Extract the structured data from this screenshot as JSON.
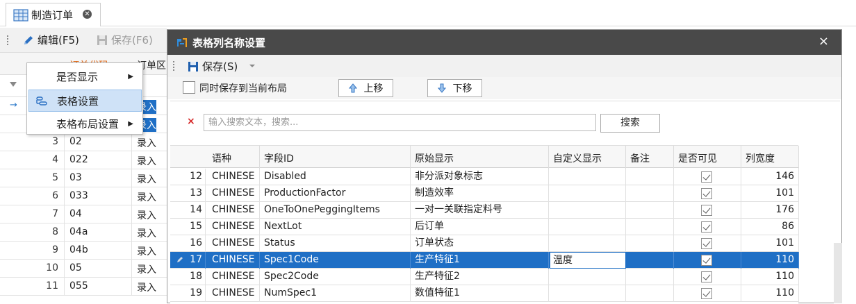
{
  "tab": {
    "label": "制造订单",
    "icon": "table-icon",
    "close_icon": "close-circle-icon"
  },
  "bg_toolbar": {
    "edit_label": "编辑(F5)",
    "save_label": "保存(F6)"
  },
  "bg_grid": {
    "header": {
      "code": "订单代码",
      "type": "订单区"
    },
    "rows": [
      {
        "num": "",
        "code": "",
        "type": "录入"
      },
      {
        "num": "",
        "code": "",
        "type": "录入"
      },
      {
        "num": "3",
        "code": "02",
        "type": "录入"
      },
      {
        "num": "4",
        "code": "022",
        "type": "录入"
      },
      {
        "num": "5",
        "code": "03",
        "type": "录入"
      },
      {
        "num": "6",
        "code": "033",
        "type": "录入"
      },
      {
        "num": "7",
        "code": "04",
        "type": "录入"
      },
      {
        "num": "8",
        "code": "04a",
        "type": "录入"
      },
      {
        "num": "9",
        "code": "04b",
        "type": "录入"
      },
      {
        "num": "10",
        "code": "05",
        "type": "录入"
      },
      {
        "num": "11",
        "code": "055",
        "type": "录入"
      }
    ]
  },
  "context_menu": {
    "items": [
      {
        "label": "是否显示",
        "has_submenu": true
      },
      {
        "label": "表格设置",
        "has_submenu": false,
        "icon": "table-settings-icon"
      },
      {
        "label": "表格布局设置",
        "has_submenu": true
      }
    ]
  },
  "dialog": {
    "title": "表格列名称设置",
    "close": "×",
    "save_label": "保存(S)",
    "sync_checkbox_label": "同时保存到当前布局",
    "move_up_label": "上移",
    "move_down_label": "下移",
    "search_placeholder": "输入搜索文本，搜索...",
    "search_button": "搜索",
    "clear_icon": "×",
    "columns": [
      "语种",
      "字段ID",
      "原始显示",
      "自定义显示",
      "备注",
      "是否可见",
      "列宽度"
    ],
    "rows": [
      {
        "num": "12",
        "lang": "CHINESE",
        "field": "Disabled",
        "orig": "非分派对象标志",
        "custom": "",
        "note": "",
        "visible": true,
        "width": "146"
      },
      {
        "num": "13",
        "lang": "CHINESE",
        "field": "ProductionFactor",
        "orig": "制造效率",
        "custom": "",
        "note": "",
        "visible": true,
        "width": "101"
      },
      {
        "num": "14",
        "lang": "CHINESE",
        "field": "OneToOnePeggingItems",
        "orig": "一对一关联指定料号",
        "custom": "",
        "note": "",
        "visible": true,
        "width": "176"
      },
      {
        "num": "15",
        "lang": "CHINESE",
        "field": "NextLot",
        "orig": "后订单",
        "custom": "",
        "note": "",
        "visible": true,
        "width": "86"
      },
      {
        "num": "16",
        "lang": "CHINESE",
        "field": "Status",
        "orig": "订单状态",
        "custom": "",
        "note": "",
        "visible": true,
        "width": "101"
      },
      {
        "num": "17",
        "lang": "CHINESE",
        "field": "Spec1Code",
        "orig": "生产特征1",
        "custom": "温度",
        "note": "",
        "visible": true,
        "width": "110",
        "selected": true
      },
      {
        "num": "18",
        "lang": "CHINESE",
        "field": "Spec2Code",
        "orig": "生产特征2",
        "custom": "",
        "note": "",
        "visible": true,
        "width": "110"
      },
      {
        "num": "19",
        "lang": "CHINESE",
        "field": "NumSpec1",
        "orig": "数值特征1",
        "custom": "",
        "note": "",
        "visible": true,
        "width": "110"
      }
    ]
  }
}
